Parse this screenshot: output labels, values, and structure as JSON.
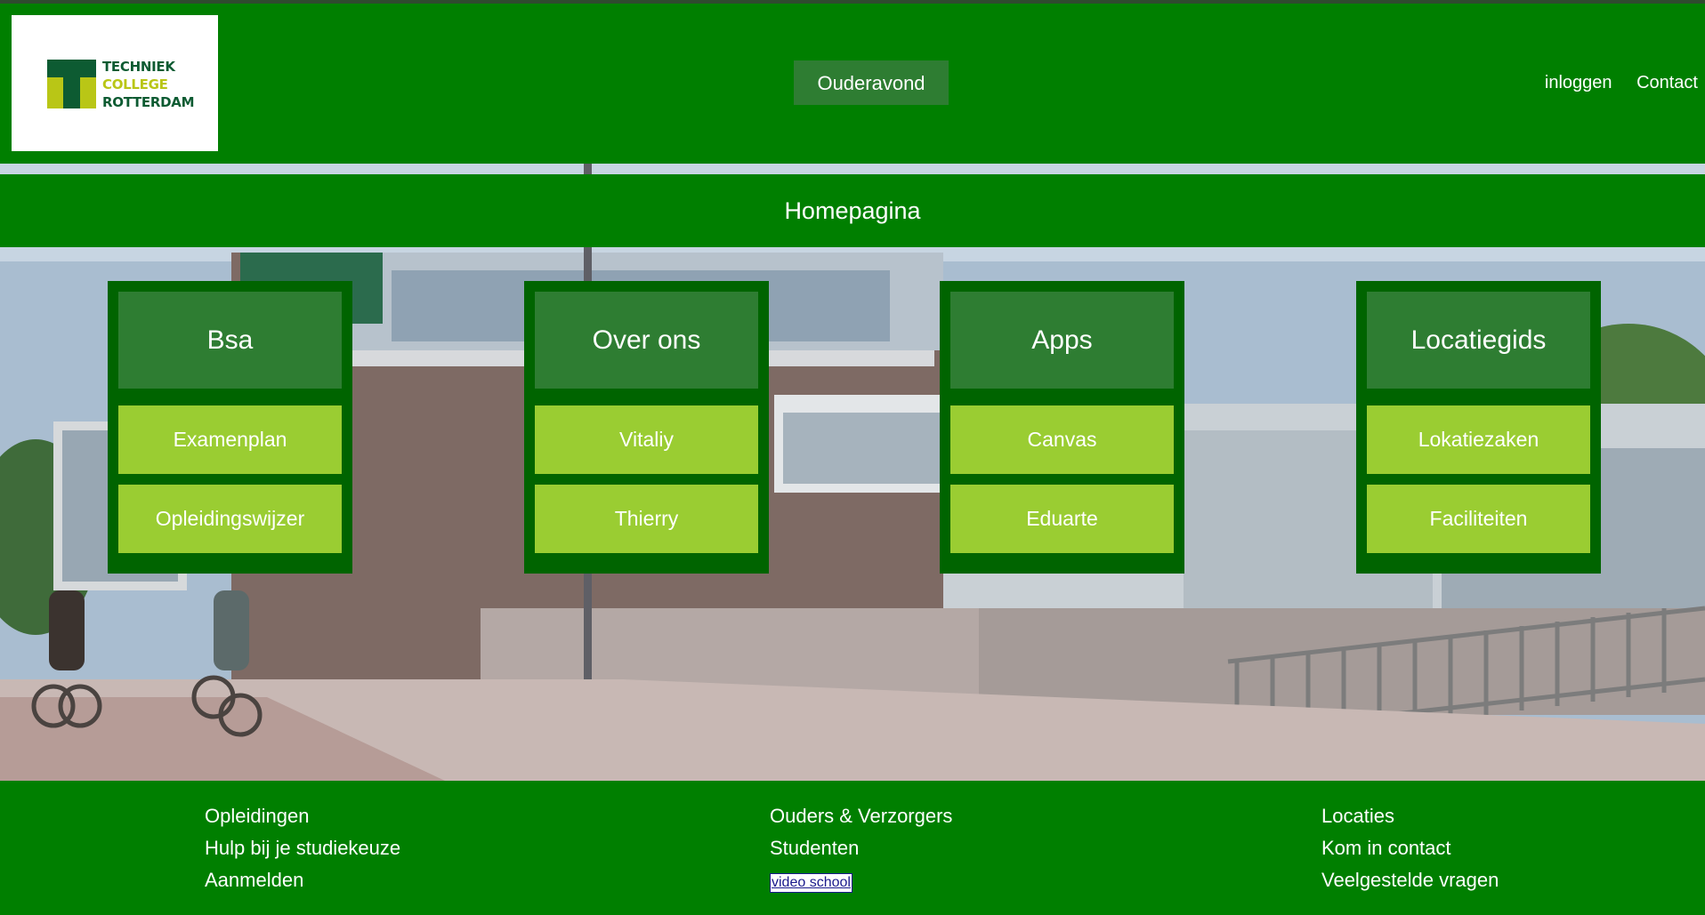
{
  "header": {
    "logo": {
      "line1": "TECHNIEK",
      "line2": "COLLEGE",
      "line3": "ROTTERDAM"
    },
    "center_button": "Ouderavond",
    "links": [
      "inloggen",
      "Contact"
    ]
  },
  "banner": {
    "title": "Homepagina"
  },
  "cards": [
    {
      "title": "Bsa",
      "items": [
        "Examenplan",
        "Opleidingswijzer"
      ]
    },
    {
      "title": "Over ons",
      "items": [
        "Vitaliy",
        "Thierry"
      ]
    },
    {
      "title": "Apps",
      "items": [
        "Canvas",
        "Eduarte"
      ]
    },
    {
      "title": "Locatiegids",
      "items": [
        "Lokatiezaken",
        "Faciliteiten"
      ]
    }
  ],
  "footer": {
    "col1": [
      "Opleidingen",
      "Hulp bij je studiekeuze",
      "Aanmelden"
    ],
    "col2": [
      "Ouders & Verzorgers",
      "Studenten",
      "video school"
    ],
    "col3": [
      "Locaties",
      "Kom in contact",
      "Veelgestelde vragen"
    ]
  },
  "colors": {
    "brand_green": "#007f00",
    "card_frame": "#006400",
    "card_head": "#2e7d32",
    "card_item": "#9acd32",
    "logo_dark": "#0d5b32",
    "logo_lime": "#b9c616"
  }
}
